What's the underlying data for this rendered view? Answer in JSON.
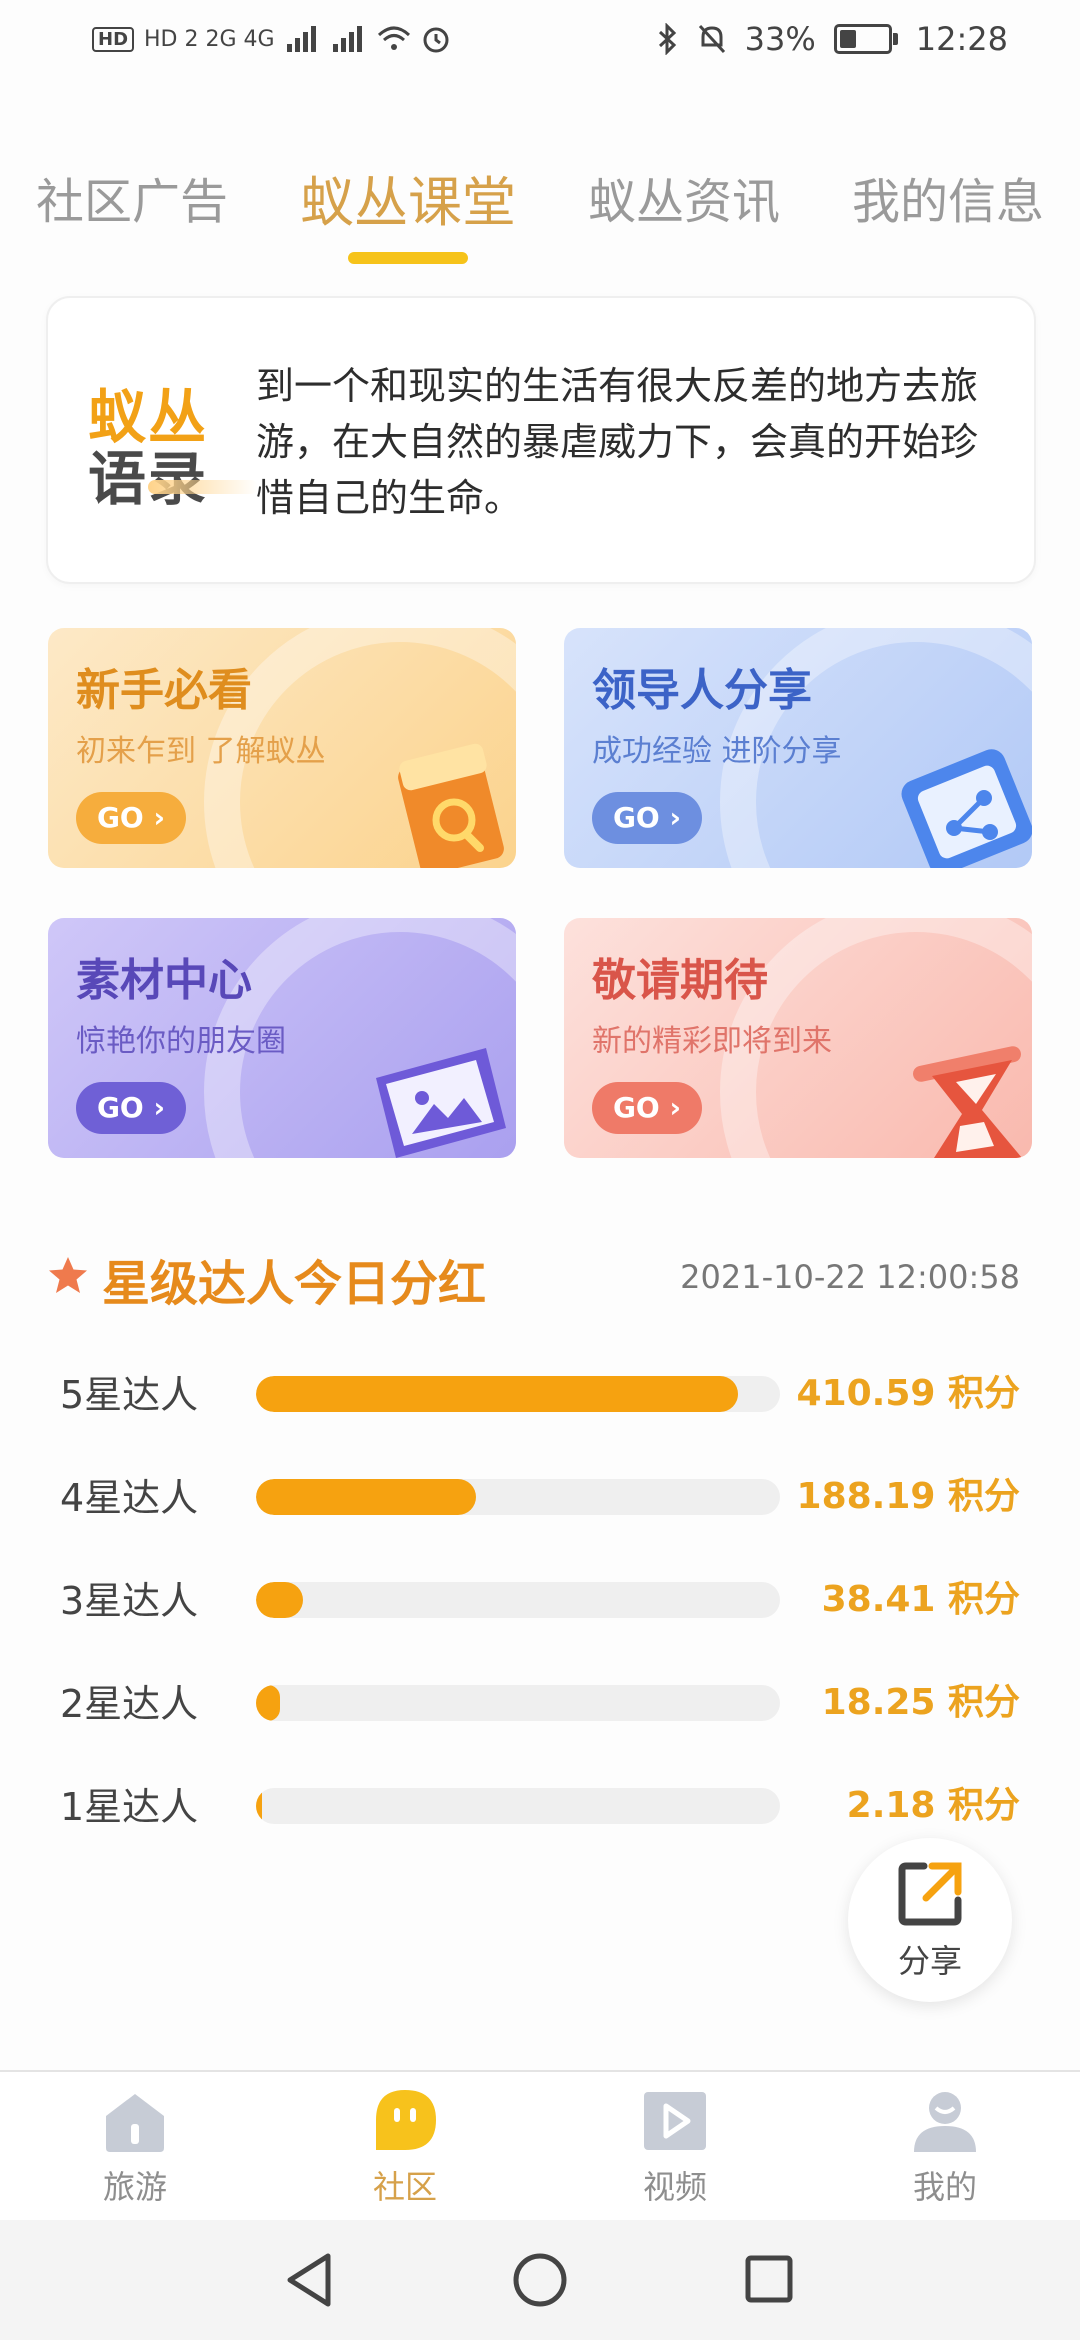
{
  "status_bar": {
    "network": "HD 2 2G 4G",
    "battery": "33%",
    "time": "12:28"
  },
  "tabs": [
    {
      "label": "社区广告",
      "active": false
    },
    {
      "label": "蚁丛课堂",
      "active": true
    },
    {
      "label": "蚁丛资讯",
      "active": false
    },
    {
      "label": "我的信息",
      "active": false
    }
  ],
  "quote": {
    "logo_line1": "蚁丛",
    "logo_line2": "语录",
    "text": "到一个和现实的生活有很大反差的地方去旅游，在大自然的暴虐威力下，会真的开始珍惜自己的生命。"
  },
  "cards": [
    {
      "title": "新手必看",
      "subtitle": "初来乍到 了解蚁丛",
      "go": "GO",
      "icon": "book-search-icon"
    },
    {
      "title": "领导人分享",
      "subtitle": "成功经验 进阶分享",
      "go": "GO",
      "icon": "share-nodes-icon"
    },
    {
      "title": "素材中心",
      "subtitle": "惊艳你的朋友圈",
      "go": "GO",
      "icon": "image-folder-icon"
    },
    {
      "title": "敬请期待",
      "subtitle": "新的精彩即将到来",
      "go": "GO",
      "icon": "hourglass-icon"
    }
  ],
  "rank": {
    "title": "星级达人今日分红",
    "timestamp": "2021-10-22 12:00:58",
    "rows": [
      {
        "label": "5星达人",
        "value": "410.59 积分",
        "progress": 0.92
      },
      {
        "label": "4星达人",
        "value": "188.19 积分",
        "progress": 0.42
      },
      {
        "label": "3星达人",
        "value": "38.41 积分",
        "progress": 0.09
      },
      {
        "label": "2星达人",
        "value": "18.25 积分",
        "progress": 0.045
      },
      {
        "label": "1星达人",
        "value": "2.18 积分",
        "progress": 0.006
      }
    ]
  },
  "share": {
    "label": "分享"
  },
  "bottom_nav": [
    {
      "label": "旅游",
      "icon": "home-icon",
      "active": false
    },
    {
      "label": "社区",
      "icon": "community-icon",
      "active": true
    },
    {
      "label": "视频",
      "icon": "video-icon",
      "active": false
    },
    {
      "label": "我的",
      "icon": "profile-icon",
      "active": false
    }
  ],
  "colors": {
    "accent": "#f6a210",
    "tab_active": "#d6a14a",
    "tab_indicator": "#f6c31a"
  }
}
